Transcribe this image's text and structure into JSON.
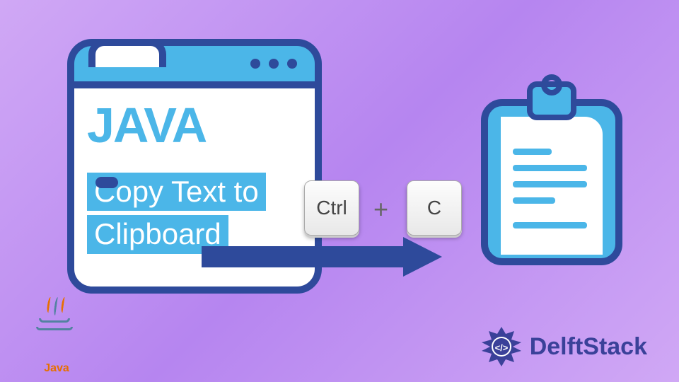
{
  "browser": {
    "heading": "JAVA",
    "title_line1": "Copy Text to",
    "title_line2": "Clipboard"
  },
  "keys": {
    "ctrl": "Ctrl",
    "plus": "+",
    "c": "C"
  },
  "java_logo": {
    "label": "Java"
  },
  "delft": {
    "label": "DelftStack"
  },
  "colors": {
    "accent_blue": "#4bb6e8",
    "dark_blue": "#2e4a9b",
    "purple": "#3a4199",
    "java_orange": "#e76f00"
  }
}
